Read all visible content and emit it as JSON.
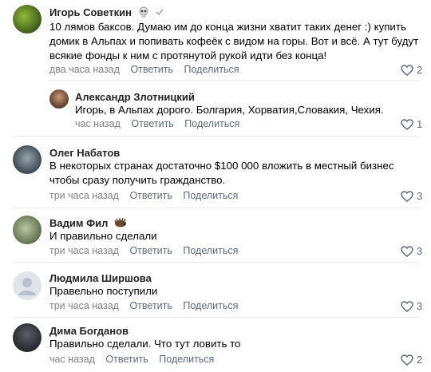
{
  "comments": [
    {
      "author": "Игорь Советкин",
      "lines": [
        "10 лямов баксов. Думаю им до конца жизни хватит таких денег :) купить",
        "домик в Альпах и попивать кофеёк с видом на горы. Вот и всё. А тут будут",
        "всякие фонды к ним с протянутой рукой идти без конца!"
      ],
      "time": "два часа назад",
      "reply": "Ответить",
      "share": "Поделиться",
      "likes": "2"
    },
    {
      "author": "Александр Злотницкий",
      "lines": [
        "Игорь, в Альпах дорого. Болгария, Хорватия,Словакия, Чехия."
      ],
      "time": "час назад",
      "reply": "Ответить",
      "share": "Поделиться",
      "likes": "1"
    },
    {
      "author": "Олег Набатов",
      "lines": [
        "В некоторых странах достаточно $100 000 вложить в местный бизнес",
        "чтобы сразу получить гражданство."
      ],
      "time": "три часа назад",
      "reply": "Ответить",
      "share": "Поделиться",
      "likes": "3"
    },
    {
      "author": "Вадим Фил",
      "lines": [
        "И правильно сделали"
      ],
      "time": "три часа назад",
      "reply": "Ответить",
      "share": "Поделиться",
      "likes": "3"
    },
    {
      "author": "Людмила Ширшова",
      "lines": [
        "Правельно поступили"
      ],
      "time": "три часа назад",
      "reply": "Ответить",
      "share": "Поделиться",
      "likes": "3"
    },
    {
      "author": "Дима Богданов",
      "lines": [
        "Правильно сделали. Что тут ловить то"
      ],
      "time": "час назад",
      "reply": "Ответить",
      "share": "Поделиться",
      "likes": "2"
    }
  ],
  "icons": {
    "like": "heart-outline-icon",
    "badge_1": "skull-icon",
    "badge_2": "checkmark-icon",
    "badge_3": "hedgehog-icon"
  },
  "colors": {
    "link": "#5f6b7a",
    "meta": "#828282",
    "divider": "#e7e8ec"
  }
}
